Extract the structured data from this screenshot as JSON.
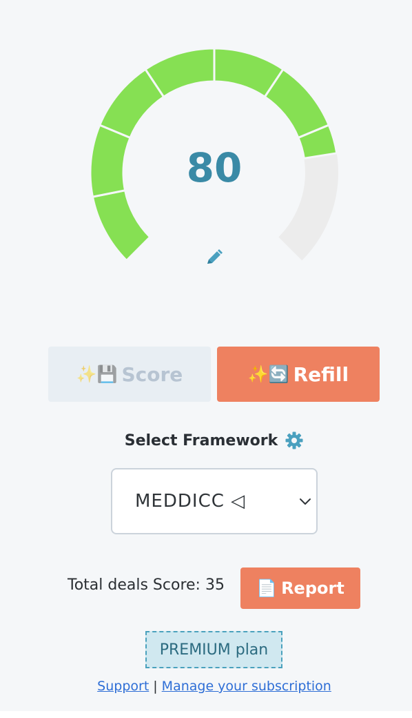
{
  "gauge": {
    "score": "80",
    "max": 100,
    "segments": 8,
    "filled_color": "#86e053",
    "empty_color": "#ececec",
    "edit_icon": "pencil-icon"
  },
  "buttons": {
    "score_emoji": "✨💾",
    "score_label": "Score",
    "refill_emoji": "✨🔄",
    "refill_label": "Refill"
  },
  "framework": {
    "label": "Select Framework",
    "settings_icon": "gear-icon",
    "selected": "MEDDICC ◁"
  },
  "summary": {
    "total_label": "Total deals Score: 35",
    "report_emoji": "📄",
    "report_label": "Report"
  },
  "plan": {
    "label": "PREMIUM plan"
  },
  "footer": {
    "support": "Support",
    "separator": "|",
    "manage": "Manage your subscription"
  },
  "colors": {
    "accent": "#ee8160",
    "score_text": "#3a8aa6",
    "link": "#2e6ed6"
  }
}
